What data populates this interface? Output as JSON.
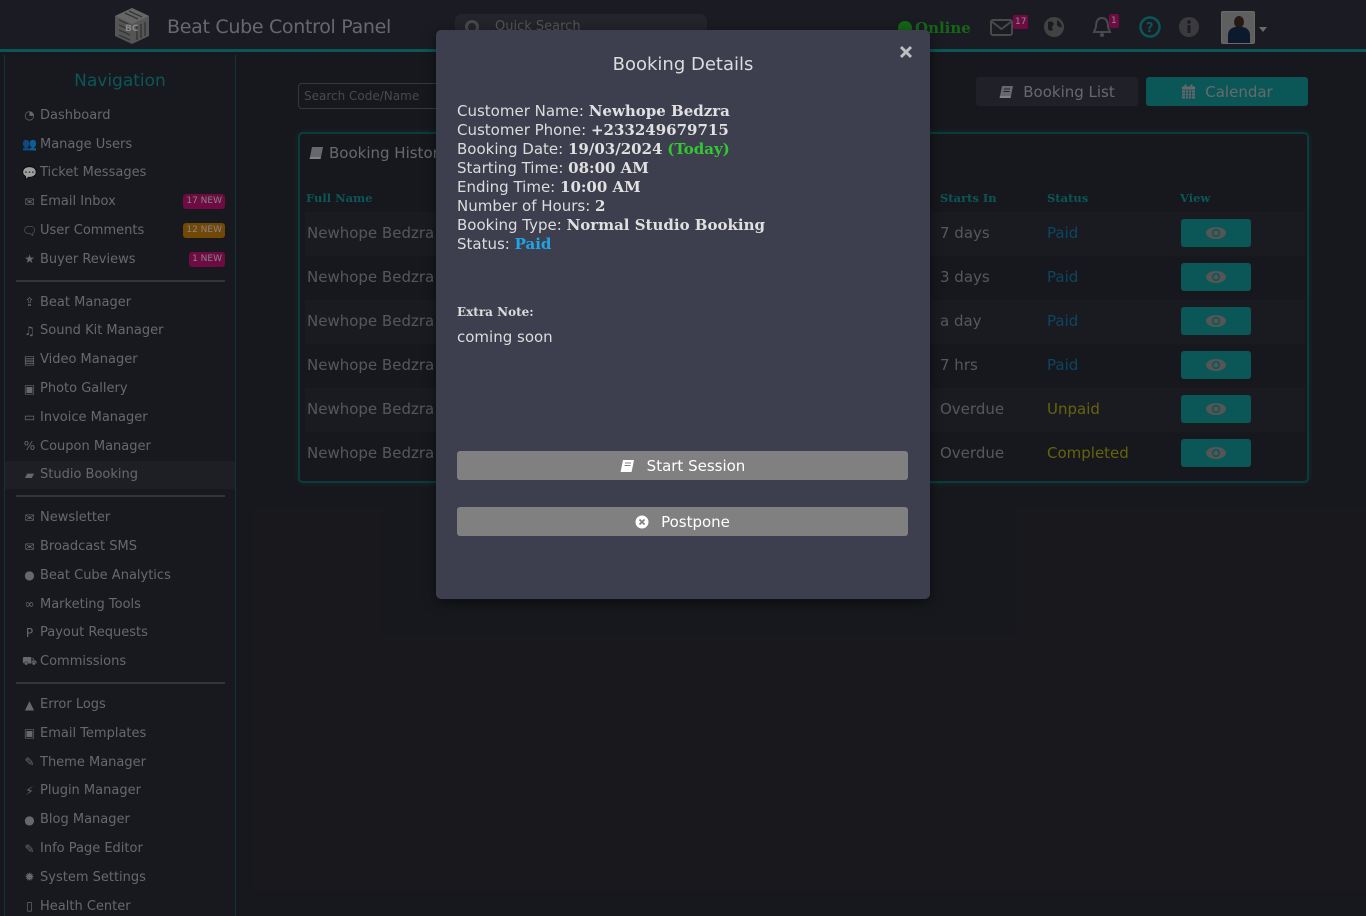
{
  "header": {
    "app_title": "Beat Cube Control Panel",
    "logo_text": "BC",
    "search_placeholder": "Quick Search",
    "online_label": "Online",
    "mail_count": "17",
    "notification_count": "1",
    "icons": [
      "mail-icon",
      "globe-icon",
      "bell-icon",
      "help-icon",
      "info-icon",
      "avatar",
      "caret-down-icon"
    ]
  },
  "sidebar": {
    "title": "Navigation",
    "groups": [
      [
        {
          "label": "Dashboard",
          "icon": "dashboard-icon"
        },
        {
          "label": "Manage Users",
          "icon": "users-icon"
        },
        {
          "label": "Ticket Messages",
          "icon": "comments-icon"
        },
        {
          "label": "Email Inbox",
          "icon": "envelope-icon",
          "badge": "17 NEW",
          "badge_color": "#b0126b"
        },
        {
          "label": "User Comments",
          "icon": "comments-outline-icon",
          "badge": "12 NEW",
          "badge_color": "#b8750a"
        },
        {
          "label": "Buyer Reviews",
          "icon": "star-icon",
          "badge": "1 NEW",
          "badge_color": "#b0126b"
        }
      ],
      [
        {
          "label": "Beat Manager",
          "icon": "upload-icon"
        },
        {
          "label": "Sound Kit Manager",
          "icon": "music-icon"
        },
        {
          "label": "Video Manager",
          "icon": "film-icon"
        },
        {
          "label": "Photo Gallery",
          "icon": "image-icon"
        },
        {
          "label": "Invoice Manager",
          "icon": "money-icon"
        },
        {
          "label": "Coupon Manager",
          "icon": "percent-icon"
        },
        {
          "label": "Studio Booking",
          "icon": "book-icon",
          "active": true
        }
      ],
      [
        {
          "label": "Newsletter",
          "icon": "envelope-solid-icon"
        },
        {
          "label": "Broadcast SMS",
          "icon": "envelope-icon"
        },
        {
          "label": "Beat Cube Analytics",
          "icon": "globe-icon"
        },
        {
          "label": "Marketing Tools",
          "icon": "link-icon"
        },
        {
          "label": "Payout Requests",
          "icon": "paypal-icon"
        },
        {
          "label": "Commissions",
          "icon": "cart-icon"
        }
      ],
      [
        {
          "label": "Error Logs",
          "icon": "warning-icon"
        },
        {
          "label": "Email Templates",
          "icon": "envelope-square-icon"
        },
        {
          "label": "Theme Manager",
          "icon": "brush-icon"
        },
        {
          "label": "Plugin Manager",
          "icon": "plug-icon"
        },
        {
          "label": "Blog Manager",
          "icon": "comment-icon"
        },
        {
          "label": "Info Page Editor",
          "icon": "edit-icon"
        },
        {
          "label": "System Settings",
          "icon": "gear-icon"
        },
        {
          "label": "Health Center",
          "icon": "thermometer-icon"
        }
      ]
    ]
  },
  "main": {
    "search_placeholder": "Search Code/Name",
    "booking_list_label": "Booking List",
    "calendar_label": "Calendar",
    "panel_title": "Booking History",
    "columns": {
      "full_name": "Full Name",
      "starts_in": "Starts In",
      "status": "Status",
      "view": "View"
    },
    "rows": [
      {
        "name": "Newhope Bedzra",
        "starts_in": "7 days",
        "status": "Paid",
        "status_color": "#14719e"
      },
      {
        "name": "Newhope Bedzra",
        "starts_in": "3 days",
        "status": "Paid",
        "status_color": "#14719e"
      },
      {
        "name": "Newhope Bedzra",
        "starts_in": "a day",
        "status": "Paid",
        "status_color": "#14719e"
      },
      {
        "name": "Newhope Bedzra",
        "starts_in": "7 hrs",
        "status": "Paid",
        "status_color": "#14719e"
      },
      {
        "name": "Newhope Bedzra",
        "starts_in": "Overdue",
        "status": "Unpaid",
        "status_color": "#a3a012"
      },
      {
        "name": "Newhope Bedzra",
        "starts_in": "Overdue",
        "status": "Completed",
        "status_color": "#a3a012"
      }
    ]
  },
  "modal": {
    "title": "Booking Details",
    "customer_name_label": "Customer Name:",
    "customer_name": "Newhope Bedzra",
    "customer_phone_label": "Customer Phone:",
    "customer_phone": "+233249679715",
    "booking_date_label": "Booking Date:",
    "booking_date": "19/03/2024",
    "booking_date_note": "(Today)",
    "starting_time_label": "Starting Time:",
    "starting_time": "08:00 AM",
    "ending_time_label": "Ending Time:",
    "ending_time": "10:00 AM",
    "hours_label": "Number of Hours:",
    "hours": "2",
    "booking_type_label": "Booking Type:",
    "booking_type": "Normal Studio Booking",
    "status_label": "Status:",
    "status": "Paid",
    "extra_note_label": "Extra Note:",
    "extra_note": "coming soon",
    "start_session_label": "Start Session",
    "postpone_label": "Postpone"
  },
  "colors": {
    "accent": "#138c8c",
    "online": "#21a521",
    "today": "#32c832",
    "paid": "#1fa6e6"
  }
}
